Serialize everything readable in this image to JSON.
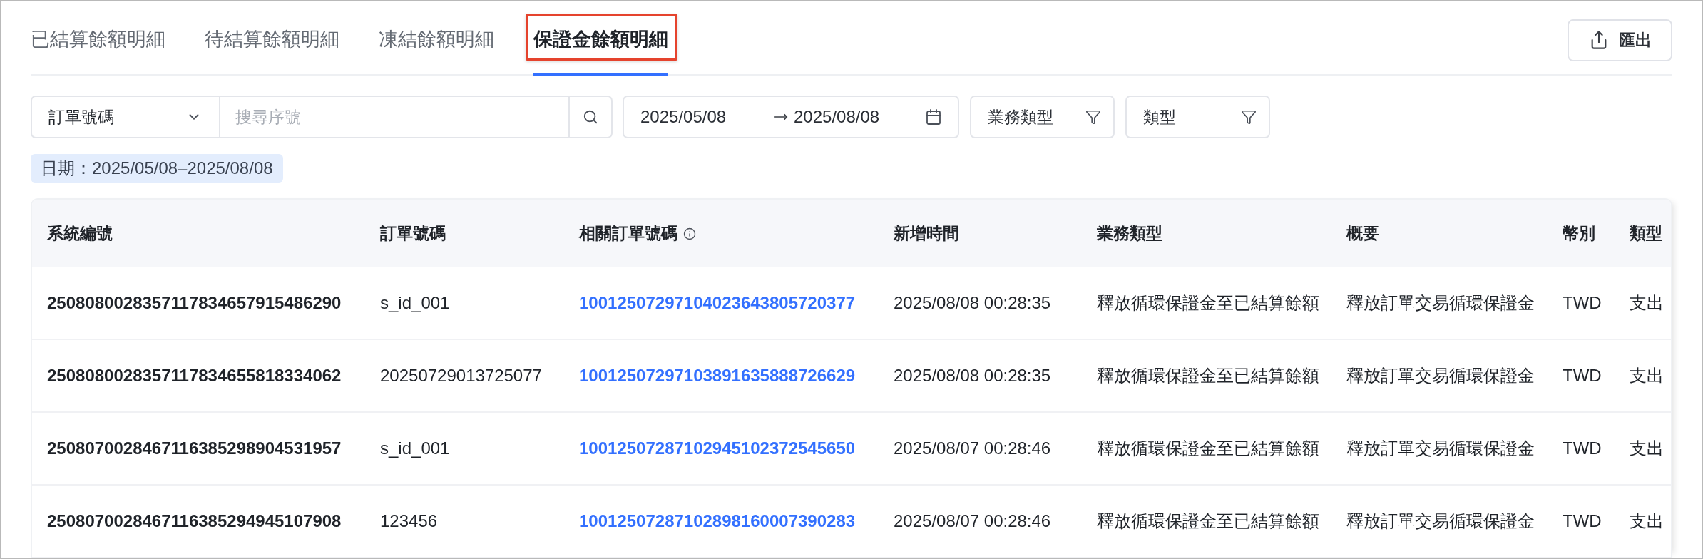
{
  "tabs": [
    {
      "label": "已結算餘額明細",
      "selected": false,
      "highlighted": false
    },
    {
      "label": "待結算餘額明細",
      "selected": false,
      "highlighted": false
    },
    {
      "label": "凍結餘額明細",
      "selected": false,
      "highlighted": false
    },
    {
      "label": "保證金餘額明細",
      "selected": true,
      "highlighted": true
    }
  ],
  "export_button": {
    "label": "匯出"
  },
  "filters": {
    "search_by": {
      "value": "訂單號碼"
    },
    "search": {
      "placeholder": "搜尋序號"
    },
    "date_range": {
      "start": "2025/05/08",
      "end": "2025/08/08"
    },
    "dropdowns": [
      {
        "label": "業務類型"
      },
      {
        "label": "類型"
      }
    ]
  },
  "applied_filter_tag": "日期：2025/05/08–2025/08/08",
  "table": {
    "columns": [
      {
        "label": "系統編號",
        "kind": "bold",
        "info": false
      },
      {
        "label": "訂單號碼",
        "kind": "text",
        "info": false
      },
      {
        "label": "相關訂單號碼",
        "kind": "link",
        "info": true
      },
      {
        "label": "新增時間",
        "kind": "text",
        "info": false
      },
      {
        "label": "業務類型",
        "kind": "text",
        "info": false
      },
      {
        "label": "概要",
        "kind": "text",
        "info": false
      },
      {
        "label": "幣別",
        "kind": "text",
        "info": false
      },
      {
        "label": "類型",
        "kind": "text",
        "info": false
      }
    ],
    "rows": [
      {
        "cells": [
          "2508080028357117834657915486290",
          "s_id_001",
          "10012507297104023643805720377",
          "2025/08/08 00:28:35",
          "釋放循環保證金至已結算餘額",
          "釋放訂單交易循環保證金",
          "TWD",
          "支出"
        ]
      },
      {
        "cells": [
          "2508080028357117834655818334062",
          "20250729013725077",
          "10012507297103891635888726629",
          "2025/08/08 00:28:35",
          "釋放循環保證金至已結算餘額",
          "釋放訂單交易循環保證金",
          "TWD",
          "支出"
        ]
      },
      {
        "cells": [
          "2508070028467116385298904531957",
          "s_id_001",
          "10012507287102945102372545650",
          "2025/08/07 00:28:46",
          "釋放循環保證金至已結算餘額",
          "釋放訂單交易循環保證金",
          "TWD",
          "支出"
        ]
      },
      {
        "cells": [
          "2508070028467116385294945107908",
          "123456",
          "10012507287102898160007390283",
          "2025/08/07 00:28:46",
          "釋放循環保證金至已結算餘額",
          "釋放訂單交易循環保證金",
          "TWD",
          "支出"
        ]
      }
    ]
  }
}
